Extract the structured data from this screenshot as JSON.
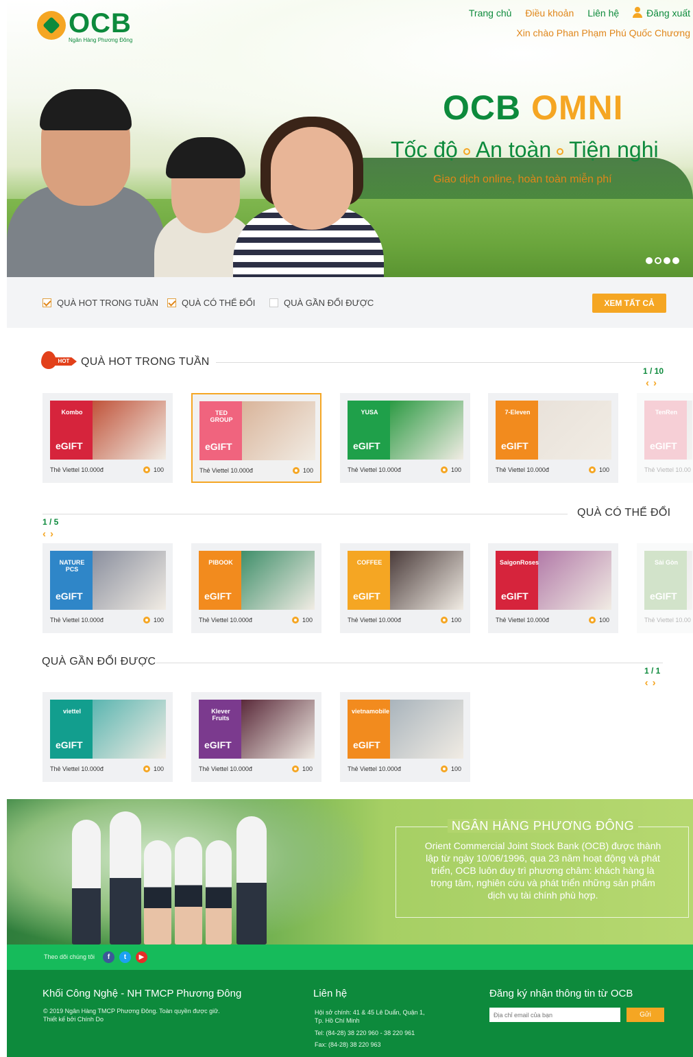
{
  "header": {
    "logo_text": "OCB",
    "logo_sub": "Ngân Hàng Phương Đông",
    "nav": [
      "Trang chủ",
      "Điều khoản",
      "Liên hệ",
      "Đăng xuất"
    ],
    "greeting": "Xin chào Phan Phạm Phú Quốc Chương"
  },
  "hero": {
    "title_part1": "OCB",
    "title_part2": "OMNI",
    "tagline": [
      "Tốc độ",
      "An toàn",
      "Tiện nghi"
    ],
    "subtitle": "Giao dịch online, hoàn toàn miễn phí",
    "slides_total": 4,
    "slide_active": 2
  },
  "filters": {
    "items": [
      {
        "label": "QUÀ HOT TRONG TUẦN",
        "checked": true
      },
      {
        "label": "QUÀ CÓ THỂ ĐỔI",
        "checked": true
      },
      {
        "label": "QUÀ GẦN ĐỔI ĐƯỢC",
        "checked": false
      }
    ],
    "view_all": "XEM TẤT CẢ"
  },
  "sections": {
    "hot": {
      "badge": "HOT",
      "title": "QUÀ HOT TRONG TUẦN",
      "pager": "1 / 10",
      "cards": [
        {
          "brand": "Kombo",
          "name": "Thẻ Viettel 10.000đ",
          "points": "100",
          "egift": "eGIFT",
          "color": "#d6243c",
          "photo": "#c0533a"
        },
        {
          "brand": "TED GROUP",
          "name": "Thẻ Viettel 10.000đ",
          "points": "100",
          "egift": "eGIFT",
          "color": "#f0647e",
          "photo": "#d9b49a"
        },
        {
          "brand": "YUSA",
          "name": "Thẻ Viettel 10.000đ",
          "points": "100",
          "egift": "eGIFT",
          "color": "#1fa04a",
          "photo": "#2c9a43"
        },
        {
          "brand": "7-Eleven",
          "name": "Thẻ Viettel 10.000đ",
          "points": "100",
          "egift": "eGIFT",
          "color": "#f28b1e",
          "photo": "#e9e2da"
        },
        {
          "brand": "TenRen",
          "name": "Thẻ Viettel 10.00",
          "points": "",
          "egift": "eGIFT",
          "color": "#e8798d",
          "photo": "#cfcfcf"
        }
      ]
    },
    "available": {
      "title": "QUÀ CÓ THỂ ĐỔI",
      "pager": "1 / 5",
      "cards": [
        {
          "brand": "NATURE PCS",
          "name": "Thẻ Viettel 10.000đ",
          "points": "100",
          "egift": "eGIFT",
          "color": "#2f86c8",
          "photo": "#8a8f9e"
        },
        {
          "brand": "PIBOOK",
          "name": "Thẻ Viettel 10.000đ",
          "points": "100",
          "egift": "eGIFT",
          "color": "#f28b1e",
          "photo": "#3f8f6a"
        },
        {
          "brand": "COFFEE",
          "name": "Thẻ Viettel 10.000đ",
          "points": "100",
          "egift": "eGIFT",
          "color": "#f5a623",
          "photo": "#4a3b3a"
        },
        {
          "brand": "SaigonRoses",
          "name": "Thẻ Viettel 10.000đ",
          "points": "100",
          "egift": "eGIFT",
          "color": "#d6243c",
          "photo": "#b27aa8"
        },
        {
          "brand": "Sài Gòn",
          "name": "Thẻ Viettel 10.00",
          "points": "",
          "egift": "eGIFT",
          "color": "#7fb06a",
          "photo": "#cfcfcf"
        }
      ]
    },
    "near": {
      "title": "QUÀ GẦN ĐỔI ĐƯỢC",
      "pager": "1 / 1",
      "cards": [
        {
          "brand": "viettel",
          "name": "Thẻ Viettel 10.000đ",
          "points": "100",
          "egift": "eGIFT",
          "color": "#129e8e",
          "photo": "#5ab5b0"
        },
        {
          "brand": "Klever Fruits",
          "name": "Thẻ Viettel 10.000đ",
          "points": "100",
          "egift": "eGIFT",
          "color": "#7b3a8e",
          "photo": "#5a2a3a"
        },
        {
          "brand": "vietnamobile",
          "name": "Thẻ Viettel 10.000đ",
          "points": "100",
          "egift": "eGIFT",
          "color": "#f28b1e",
          "photo": "#a9b4bc"
        }
      ]
    }
  },
  "banner": {
    "title": "NGÂN HÀNG PHƯƠNG ĐÔNG",
    "text": "Orient Commercial Joint Stock Bank (OCB) được thành lập từ ngày 10/06/1996, qua 23 năm hoạt động và phát triển, OCB luôn duy trì phương châm: khách hàng là trọng tâm, nghiên cứu và phát triển những sản phẩm dịch vụ tài chính phù hợp."
  },
  "follow": {
    "label": "Theo dõi chúng tôi",
    "icons": [
      "facebook-icon",
      "twitter-icon",
      "youtube-icon"
    ]
  },
  "footer": {
    "col1_title": "Khối Công Nghệ - NH TMCP Phương Đông",
    "col1_line1": "© 2019 Ngân Hàng TMCP Phương Đông. Toàn quyền được giữ.",
    "col1_line2": "Thiết kế bởi Chính Do",
    "col2_title": "Liên hệ",
    "col2_addr1": "Hội sở chính: 41 & 45 Lê Duẩn, Quận 1,",
    "col2_addr2": "Tp. Hồ Chí Minh",
    "col2_tel": "Tel: (84-28) 38 220 960 - 38 220 961",
    "col2_fax": "Fax: (84-28) 38 220 963",
    "col3_title": "Đăng ký nhận thông tin từ OCB",
    "email_placeholder": "Địa chỉ email của bạn",
    "send": "Gửi"
  }
}
